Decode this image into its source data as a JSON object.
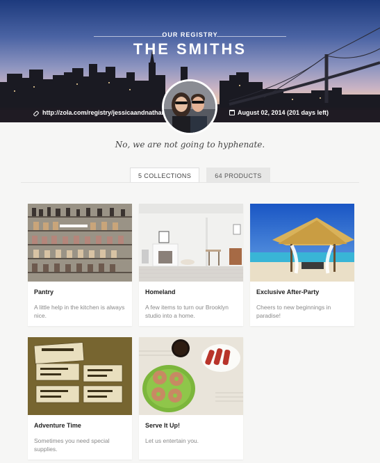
{
  "hero": {
    "eyebrow": "OUR REGISTRY",
    "title": "THE SMITHS",
    "url": "http://zola.com/registry/jessicaandnathan",
    "date": "August 02, 2014 (201 days left)"
  },
  "tagline": "No, we are not going to hyphenate.",
  "tabs": [
    {
      "label": "5 COLLECTIONS",
      "active": true
    },
    {
      "label": "64 PRODUCTS",
      "active": false
    }
  ],
  "collections": [
    {
      "title": "Pantry",
      "description": "A little help in the kitchen is always nice.",
      "image": "pantry-shelves"
    },
    {
      "title": "Homeland",
      "description": "A few items to turn our Brooklyn studio into a home.",
      "image": "white-living-room"
    },
    {
      "title": "Exclusive After-Party",
      "description": "Cheers to new beginnings in paradise!",
      "image": "beach-cabana"
    },
    {
      "title": "Adventure Time",
      "description": "Sometimes you need special supplies.",
      "image": "luggage-tags"
    },
    {
      "title": "Serve It Up!",
      "description": "Let us entertain you.",
      "image": "donuts-bacon-breakfast"
    }
  ],
  "colors": {
    "background": "#f6f6f5",
    "card": "#ffffff",
    "muted_text": "#888888"
  }
}
